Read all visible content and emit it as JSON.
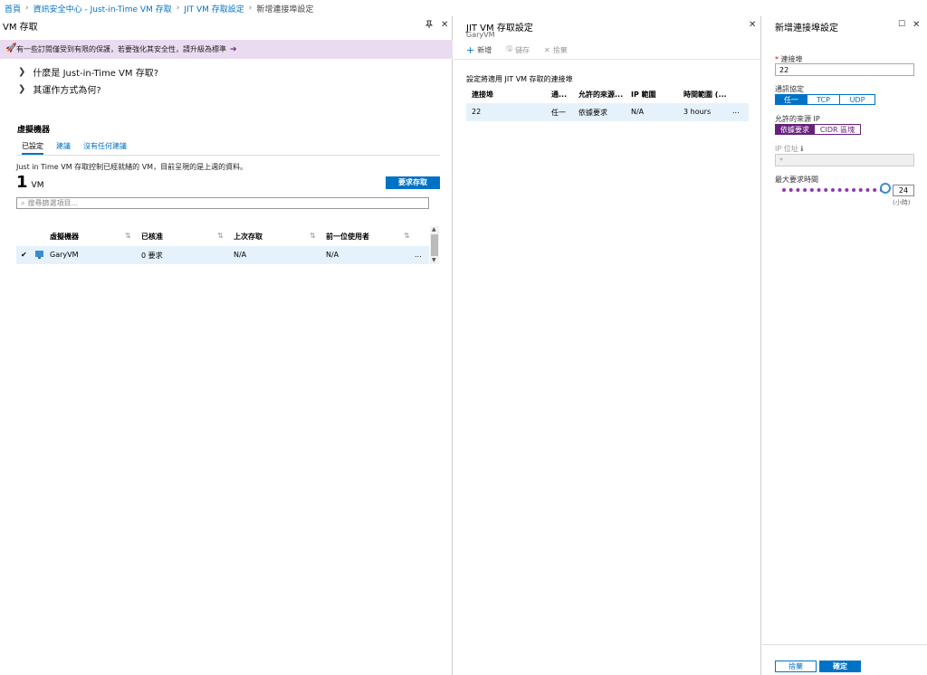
{
  "breadcrumb": {
    "items": [
      "首頁",
      "資訊安全中心 - Just-in-Time VM 存取",
      "JIT VM 存取設定",
      "新增連接埠設定"
    ],
    "sep": "›"
  },
  "blade1": {
    "title": "VM 存取",
    "banner": "有一些訂閱僅受到有限的保護，若要強化其安全性，請升級為標準",
    "banner_arrow": "➔",
    "expanders": [
      "什麼是 Just-in-Time VM 存取?",
      "其運作方式為何?"
    ],
    "section_title": "虛擬機器",
    "tabs": [
      "已設定",
      "建議",
      "沒有任何建議"
    ],
    "description": "Just in Time VM 存取控制已經就緒的 VM，目前呈現的是上週的資料。",
    "count": "1",
    "count_unit": "VM",
    "request_button": "要求存取",
    "search_placeholder": "搜尋篩選項目...",
    "table": {
      "columns": [
        "虛擬機器",
        "已核准",
        "上次存取",
        "前一位使用者"
      ],
      "rows": [
        {
          "checked": "✔",
          "vm": "GaryVM",
          "approved": "0 要求",
          "last_access": "N/A",
          "last_user": "N/A",
          "more": "..."
        }
      ]
    }
  },
  "blade2": {
    "title": "JIT VM 存取設定",
    "subtitle": "GaryVM",
    "toolbar": {
      "add": "新增",
      "save": "儲存",
      "discard": "捨棄"
    },
    "section": "設定將適用 JIT VM 存取的連接埠",
    "table": {
      "columns": [
        "連接埠",
        "通...",
        "允許的來源...",
        "IP 範圍",
        "時間範圍 (..."
      ],
      "rows": [
        {
          "port": "22",
          "protocol": "任一",
          "source": "依據要求",
          "ip_range": "N/A",
          "time": "3 hours",
          "more": "..."
        }
      ]
    }
  },
  "blade3": {
    "title": "新增連接埠設定",
    "port_label": "連接埠",
    "port_value": "22",
    "protocol_label": "通訊協定",
    "protocol_options": [
      "任一",
      "TCP",
      "UDP"
    ],
    "source_label": "允許的來源 IP",
    "source_options": [
      "依據要求",
      "CIDR 區塊"
    ],
    "ip_label": "IP 位址",
    "ip_value": "*",
    "max_time_label": "最大要求時間",
    "max_time_value": "24",
    "max_time_unit": "(小時)",
    "max_time_fraction": 1.0,
    "discard_button": "捨棄",
    "ok_button": "確定"
  }
}
